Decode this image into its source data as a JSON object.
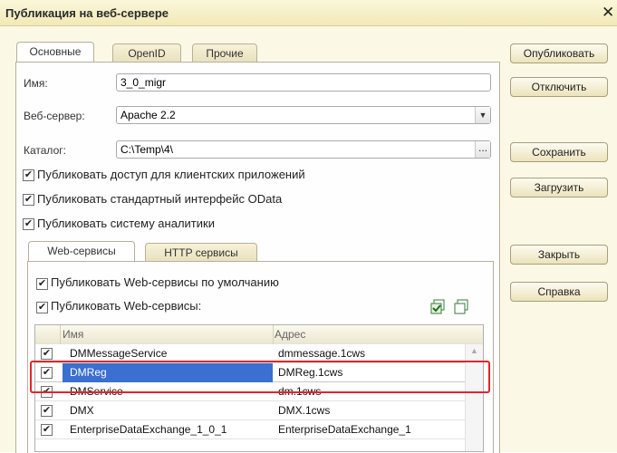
{
  "window": {
    "title": "Публикация на веб-сервере",
    "close_glyph": "✕"
  },
  "tabs": [
    {
      "label": "Основные",
      "active": true
    },
    {
      "label": "OpenID",
      "active": false
    },
    {
      "label": "Прочие",
      "active": false
    }
  ],
  "form": {
    "name_label": "Имя:",
    "name_value": "3_0_migr",
    "server_label": "Веб-сервер:",
    "server_value": "Apache 2.2",
    "catalog_label": "Каталог:",
    "catalog_value": "C:\\Temp\\4\\",
    "catalog_button": "...",
    "dropdown_glyph": "▼"
  },
  "options": [
    {
      "label": "Публиковать доступ для клиентских приложений",
      "checked": true
    },
    {
      "label": "Публиковать стандартный интерфейс OData",
      "checked": true
    },
    {
      "label": "Публиковать систему аналитики",
      "checked": true
    }
  ],
  "subtabs": [
    {
      "label": "Web-сервисы",
      "active": true
    },
    {
      "label": "HTTP сервисы",
      "active": false
    }
  ],
  "ws_options": [
    {
      "label": "Публиковать Web-сервисы по умолчанию",
      "checked": true
    },
    {
      "label": "Публиковать Web-сервисы:",
      "checked": true
    }
  ],
  "check_glyph": "✔",
  "table": {
    "columns": [
      "Имя",
      "Адрес"
    ],
    "rows": [
      {
        "name": "DMMessageService",
        "address": "dmmessage.1cws",
        "checked": true,
        "selected": false
      },
      {
        "name": "DMReg",
        "address": "DMReg.1cws",
        "checked": true,
        "selected": true
      },
      {
        "name": "DMService",
        "address": "dm.1cws",
        "checked": true,
        "selected": false
      },
      {
        "name": "DMX",
        "address": "DMX.1cws",
        "checked": true,
        "selected": false
      },
      {
        "name": "EnterpriseDataExchange_1_0_1",
        "address": "EnterpriseDataExchange_1",
        "checked": true,
        "selected": false
      }
    ]
  },
  "buttons": {
    "publish": "Опубликовать",
    "disable": "Отключить",
    "save": "Сохранить",
    "load": "Загрузить",
    "close": "Закрыть",
    "help": "Справка"
  },
  "icons": [
    "check-all-icon",
    "uncheck-all-icon"
  ]
}
